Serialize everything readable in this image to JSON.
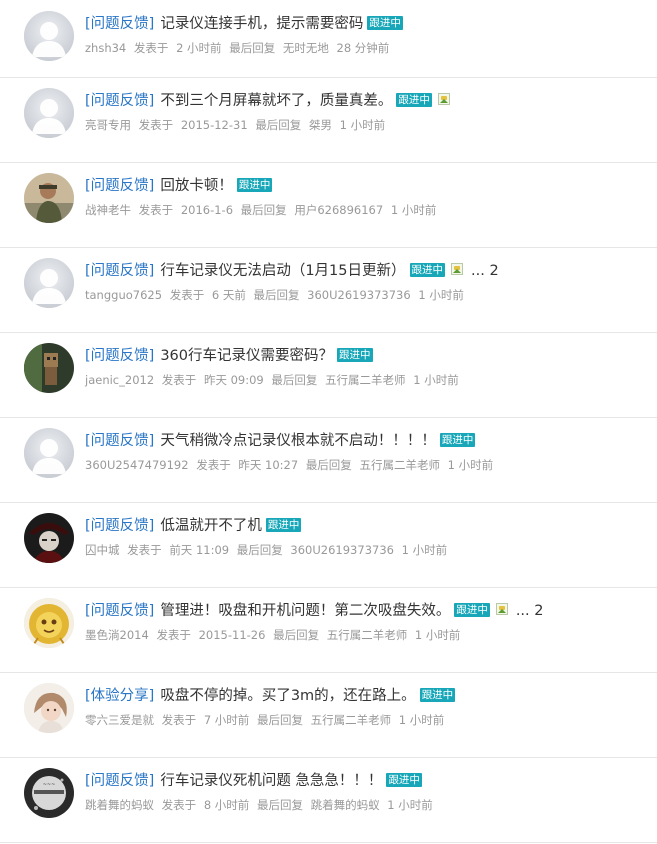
{
  "colors": {
    "category_link": "#2a76c6",
    "badge_bg": "#18a7b8",
    "meta_text": "#999999",
    "title_text": "#333333"
  },
  "threads": [
    {
      "avatar": "default-avatar",
      "category": "[问题反馈]",
      "title": "记录仪连接手机，提示需要密码",
      "badge": "跟进中",
      "has_image": false,
      "pages": "",
      "author": "zhsh34",
      "posted_label": "发表于",
      "posted": "2 小时前",
      "reply_label": "最后回复",
      "last_replier": "无时无地",
      "last_time": "28 分钟前"
    },
    {
      "avatar": "default-avatar",
      "category": "[问题反馈]",
      "title": "不到三个月屏幕就坏了，质量真差。",
      "badge": "跟进中",
      "has_image": true,
      "pages": "",
      "author": "亮哥专用",
      "posted_label": "发表于",
      "posted": "2015-12-31",
      "reply_label": "最后回复",
      "last_replier": "桀男",
      "last_time": "1 小时前"
    },
    {
      "avatar": "photo-soldier",
      "category": "[问题反馈]",
      "title": "回放卡顿！",
      "badge": "跟进中",
      "has_image": false,
      "pages": "",
      "author": "战神老牛",
      "posted_label": "发表于",
      "posted": "2016-1-6",
      "reply_label": "最后回复",
      "last_replier": "用户626896167",
      "last_time": "1 小时前"
    },
    {
      "avatar": "default-avatar",
      "category": "[问题反馈]",
      "title": "行车记录仪无法启动（1月15日更新）",
      "badge": "跟进中",
      "has_image": true,
      "pages": "... 2",
      "author": "tangguo7625",
      "posted_label": "发表于",
      "posted": "6 天前",
      "reply_label": "最后回复",
      "last_replier": "360U2619373736",
      "last_time": "1 小时前"
    },
    {
      "avatar": "photo-figure",
      "category": "[问题反馈]",
      "title": "360行车记录仪需要密码？",
      "badge": "跟进中",
      "has_image": false,
      "pages": "",
      "author": "jaenic_2012",
      "posted_label": "发表于",
      "posted": "昨天 09:09",
      "reply_label": "最后回复",
      "last_replier": "五行属二羊老师",
      "last_time": "1 小时前"
    },
    {
      "avatar": "default-avatar",
      "category": "[问题反馈]",
      "title": "天气稍微冷点记录仪根本就不启动！！！！",
      "badge": "跟进中",
      "has_image": false,
      "pages": "",
      "author": "360U2547479192",
      "posted_label": "发表于",
      "posted": "昨天 10:27",
      "reply_label": "最后回复",
      "last_replier": "五行属二羊老师",
      "last_time": "1 小时前"
    },
    {
      "avatar": "photo-dark",
      "category": "[问题反馈]",
      "title": "低温就开不了机",
      "badge": "跟进中",
      "has_image": false,
      "pages": "",
      "author": "囚中城",
      "posted_label": "发表于",
      "posted": "前天 11:09",
      "reply_label": "最后回复",
      "last_replier": "360U2619373736",
      "last_time": "1 小时前"
    },
    {
      "avatar": "photo-lion",
      "category": "[问题反馈]",
      "title": "管理进！吸盘和开机问题！第二次吸盘失效。",
      "badge": "跟进中",
      "has_image": true,
      "pages": "... 2",
      "author": "墨色淌2014",
      "posted_label": "发表于",
      "posted": "2015-11-26",
      "reply_label": "最后回复",
      "last_replier": "五行属二羊老师",
      "last_time": "1 小时前"
    },
    {
      "avatar": "photo-girl",
      "category": "[体验分享]",
      "title": "吸盘不停的掉。买了3m的，还在路上。",
      "badge": "跟进中",
      "has_image": false,
      "pages": "",
      "author": "零六三爱是就",
      "posted_label": "发表于",
      "posted": "7 小时前",
      "reply_label": "最后回复",
      "last_replier": "五行属二羊老师",
      "last_time": "1 小时前"
    },
    {
      "avatar": "photo-bw",
      "category": "[问题反馈]",
      "title": "行车记录仪死机问题 急急急！！！",
      "badge": "跟进中",
      "has_image": false,
      "pages": "",
      "author": "跳着舞的蚂蚁",
      "posted_label": "发表于",
      "posted": "8 小时前",
      "reply_label": "最后回复",
      "last_replier": "跳着舞的蚂蚁",
      "last_time": "1 小时前"
    }
  ]
}
